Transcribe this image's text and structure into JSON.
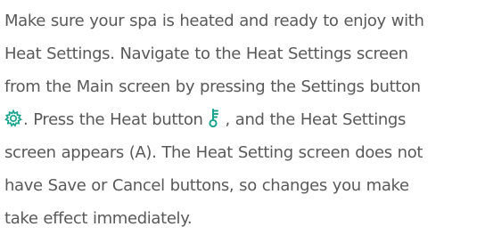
{
  "paragraph": {
    "line1": "Make sure your spa is heated and ready to enjoy with",
    "line2": "Heat Settings. Navigate to the Heat Settings screen",
    "line3": "from the Main screen by pressing the Settings button",
    "line4_after_settings_icon": ". Press the Heat button",
    "line4_after_heat_icon": ", and the Heat Settings",
    "line5": "screen appears (A). The Heat Setting screen does not",
    "line6": "have Save or Cancel buttons, so changes you make",
    "line7": "take effect immediately."
  },
  "icons": {
    "settings": "settings-gear-icon",
    "heat": "heat-thermometer-icon"
  },
  "colors": {
    "text": "#595959",
    "icon_accent": "#1aa38f"
  }
}
